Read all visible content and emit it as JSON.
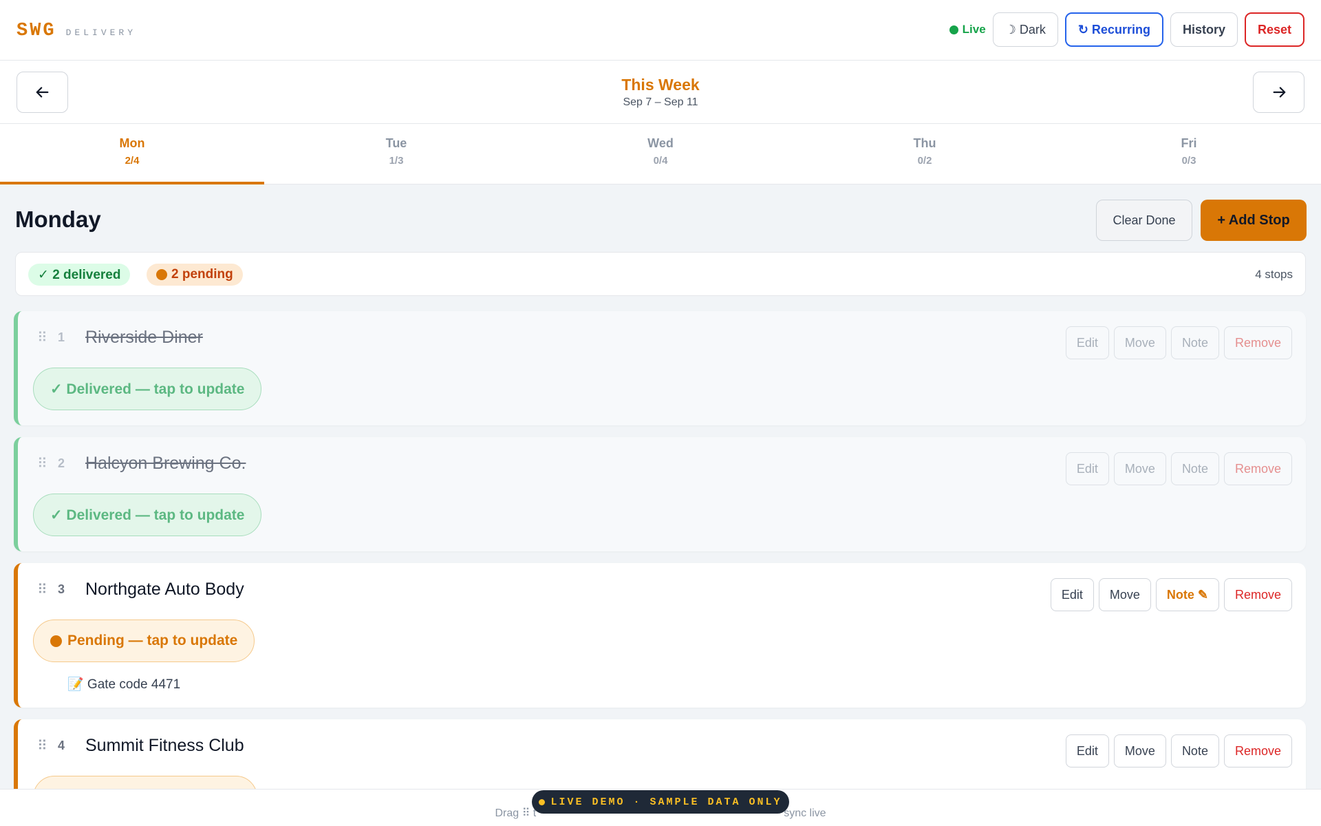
{
  "brand": {
    "name": "SWG",
    "sub": "DELIVERY"
  },
  "toolbar": {
    "live_label": "Live",
    "dark_label": "☽ Dark",
    "recurring_label": "↻ Recurring",
    "history_label": "History",
    "reset_label": "Reset"
  },
  "week": {
    "title": "This Week",
    "range": "Sep 7 – Sep 11"
  },
  "days": [
    {
      "name": "Mon",
      "count": "2/4"
    },
    {
      "name": "Tue",
      "count": "1/3"
    },
    {
      "name": "Wed",
      "count": "0/4"
    },
    {
      "name": "Thu",
      "count": "0/2"
    },
    {
      "name": "Fri",
      "count": "0/3"
    }
  ],
  "day": {
    "title": "Monday",
    "clear_label": "Clear Done",
    "add_label": "+ Add Stop"
  },
  "summary": {
    "delivered": "✓ 2 delivered",
    "pending": "2 pending",
    "stops": "4 stops"
  },
  "stop_actions": {
    "edit": "Edit",
    "move": "Move",
    "note": "Note",
    "note_with": "Note ✎",
    "remove": "Remove"
  },
  "stops": [
    {
      "num": "1",
      "name": "Riverside Diner",
      "status": "✓ Delivered — tap to update"
    },
    {
      "num": "2",
      "name": "Halcyon Brewing Co.",
      "status": "✓ Delivered — tap to update"
    },
    {
      "num": "3",
      "name": "Northgate Auto Body",
      "status": "Pending — tap to update",
      "note": "📝 Gate code 4471"
    },
    {
      "num": "4",
      "name": "Summit Fitness Club"
    }
  ],
  "footer": {
    "left": "Drag ⠿ t",
    "right": "sync live"
  },
  "demo_badge": "LIVE DEMO · SAMPLE DATA ONLY",
  "colors": {
    "accent": "#d97706",
    "success": "#16a34a",
    "danger": "#dc2626",
    "info": "#2563eb"
  }
}
